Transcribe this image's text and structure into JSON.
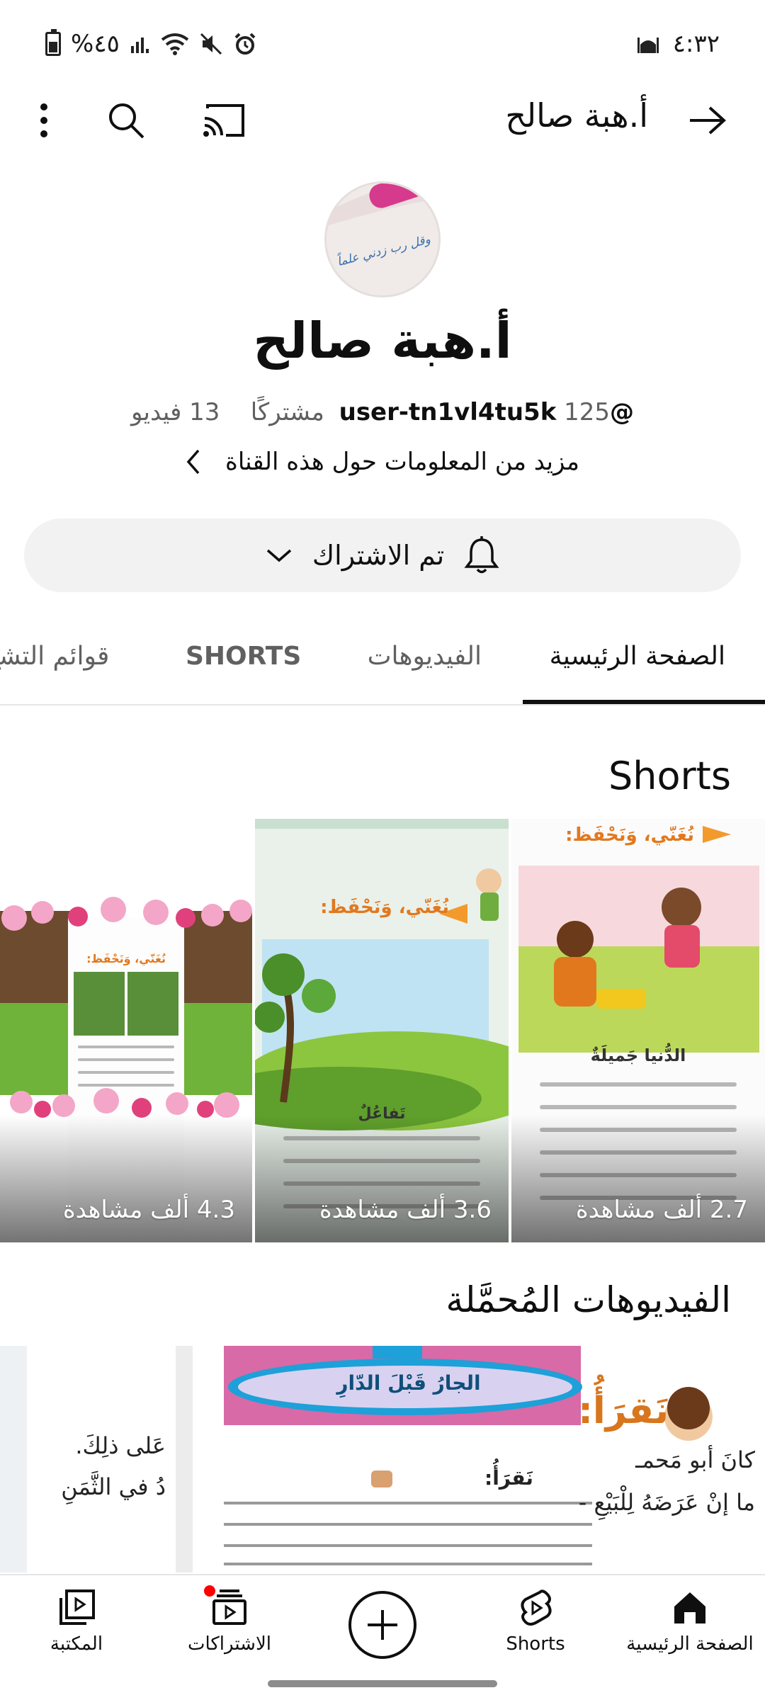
{
  "status_bar": {
    "battery_text": "%٤٥",
    "time": "٤:٣٢"
  },
  "app_bar": {
    "title": "أ.هبة صالح"
  },
  "channel": {
    "avatar_text": "وقل رب زدني علماً",
    "name": "أ.هبة صالح",
    "handle": "@user-tn1vl4tu5k",
    "subscribers": "125 مشتركًا",
    "videos": "13 فيديو",
    "more_info": "مزيد من المعلومات حول هذه القناة",
    "subscribe_label": "تم الاشتراك"
  },
  "tabs": [
    {
      "label": "الصفحة الرئيسية",
      "active": true
    },
    {
      "label": "الفيديوهات",
      "active": false
    },
    {
      "label": "SHORTS",
      "active": false
    },
    {
      "label": "قوائم التشغ",
      "active": false
    }
  ],
  "shorts_section": {
    "title": "Shorts",
    "items": [
      {
        "views": "2.7 ألف مشاهدة",
        "page_heading": "نُغَنّي، وَنَحْفَظ:",
        "poem_title": "الدُّنيا جَميلَةٌ"
      },
      {
        "views": "3.6 ألف مشاهدة",
        "page_heading": "نُغَنّي، وَنَحْفَظ:",
        "poem_title": "تَفاعُلٌ"
      },
      {
        "views": "4.3 ألف مشاهدة",
        "page_heading": "نُغَنّي، وَنَحْفَظ:"
      }
    ]
  },
  "downloads_section": {
    "title": "الفيديوهات المُحمَّلة",
    "card_banner": "الجارُ قَبْلَ الدّارِ",
    "card_heading": "نَقرَأُ:",
    "side_text_1": "عَلى ذلِكَ.",
    "side_text_2": "دُ في الثَّمَنِ",
    "text_line_1": "كانَ أبو مَحمـ",
    "text_line_2": "ما إنْ عَرَضَهُ لِلْبَيْعِ -"
  },
  "bottom_nav": [
    {
      "label": "الصفحة الرئيسية",
      "icon": "home-icon",
      "active": true
    },
    {
      "label": "Shorts",
      "icon": "shorts-icon",
      "active": false
    },
    {
      "label": "",
      "icon": "create-icon",
      "active": false
    },
    {
      "label": "الاشتراكات",
      "icon": "subscriptions-icon",
      "active": false,
      "badge": true
    },
    {
      "label": "المكتبة",
      "icon": "library-icon",
      "active": false
    }
  ],
  "colors": {
    "accent": "#0f0f0f",
    "secondary_text": "#606060",
    "badge": "#ff0000",
    "button_bg": "#f2f2f2"
  }
}
